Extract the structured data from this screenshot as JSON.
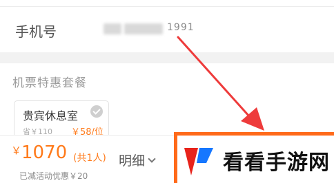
{
  "contact": {
    "phone_label": "手机号",
    "phone_visible_digits": "1991"
  },
  "package": {
    "section_title": "机票特惠套餐",
    "card": {
      "name": "贵宾休息室",
      "saving": "省￥110",
      "price": "￥58/位"
    }
  },
  "footer": {
    "currency_symbol": "￥",
    "total_price": "1070",
    "people": "(共1人)",
    "discount": "已减活动优惠￥20",
    "detail_label": "明细"
  },
  "watermark": {
    "text": "看看手游网"
  },
  "colors": {
    "accent": "#ff7a1a",
    "arrow": "#ee3b3b",
    "watermark_border": "#ff6a1a"
  },
  "icons": [
    "check-icon",
    "chevron-down-icon",
    "watermark-logo-icon",
    "annotation-arrow"
  ]
}
